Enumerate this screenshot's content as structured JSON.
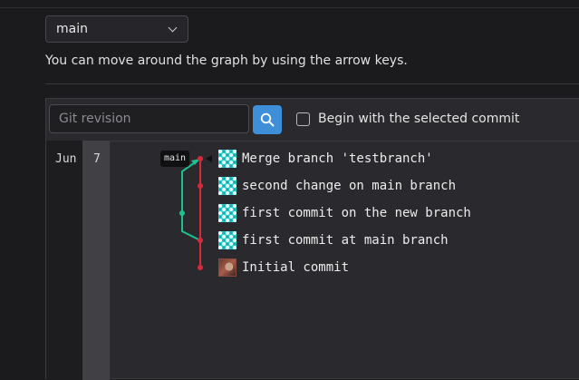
{
  "branch_selector": {
    "value": "main",
    "icon": "chevron-down-icon"
  },
  "help_text": "You can move around the graph by using the arrow keys.",
  "toolbar": {
    "revision_placeholder": "Git revision",
    "search_icon": "search-icon",
    "begin_checkbox_label": "Begin with the selected commit",
    "begin_checkbox_checked": false,
    "search_button_color": "#3f8ed8"
  },
  "graph": {
    "month": "Jun",
    "day": "7",
    "ref_tag": "main",
    "colors": {
      "main": "#d62b3b",
      "branch": "#1fbf8f"
    },
    "commits": [
      {
        "message": "Merge branch 'testbranch'",
        "avatar": "identicon"
      },
      {
        "message": "second change on main branch",
        "avatar": "identicon"
      },
      {
        "message": "first commit on the new branch",
        "avatar": "identicon"
      },
      {
        "message": "first commit at main branch",
        "avatar": "identicon"
      },
      {
        "message": "Initial commit",
        "avatar": "photo"
      }
    ]
  }
}
